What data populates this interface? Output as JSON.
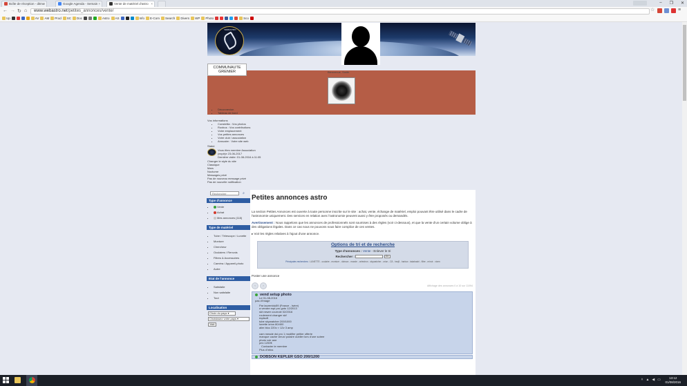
{
  "browser": {
    "tabs": [
      {
        "label": "Boîte de réception - ditmo",
        "favicon_color": "#d44638"
      },
      {
        "label": "Google Agenda - Semain",
        "favicon_color": "#4285f4"
      },
      {
        "label": "Vente de matériel d'astro",
        "favicon_color": "#333333"
      }
    ],
    "url_host": "www.webastro.net",
    "url_path": "/petites_annonces/vente/",
    "bookmarks": [
      "Up",
      "AV",
      "AM",
      "Prod",
      "SC",
      "Doc",
      "Astro",
      "AS",
      "Info",
      "E-Com",
      "Search",
      "Divers",
      "WP",
      "Photo",
      "Sco"
    ]
  },
  "site": {
    "logo_text": "WEBASTRO",
    "grenier_line1": "COMMUNAUTE",
    "grenier_line2": "GRENIER",
    "member_name": "Bienvenue, Smith",
    "user_links": [
      "Déconnexion",
      "Tableau de bord"
    ],
    "infos_label": "Vos informations",
    "info_links": [
      "Constellia : Vos photos",
      "Roxbus : Vos contributions",
      "Votre emplacement",
      "Vos petites annonces",
      "Votre club / association",
      "Annuaire : Votre site web"
    ],
    "statut_label": "Statut",
    "statut_line1": "Vous êtes membre Association",
    "statut_line2": "(expir)e 23-06-2017",
    "statut_line3": "Dernière visite: 01-08-2016 à 11:05",
    "style_label": "Changer le style du site",
    "styles": [
      "Classique",
      "Mars",
      "Nocturne"
    ],
    "messages_label": "Messages privé",
    "no_new_message": "Pas de nouveau message privé",
    "no_notification": "Pas de nouvelle notification"
  },
  "sidebar": {
    "search_placeholder": "Rechercher",
    "type_annonce_title": "Type d'annonce",
    "type_annonce": [
      {
        "label": "Vente",
        "color": "#3aa33a"
      },
      {
        "label": "Achat",
        "color": "#d33a2b"
      },
      {
        "label": "Mes annonces (118)",
        "color": "#c7c7c7"
      }
    ],
    "type_materiel_title": "Type de matériel",
    "type_materiel": [
      "Tube / Télescope / Lunette",
      "Monture",
      "Chercheur",
      "Oculaires / Renvois",
      "Filtres & Accessoires",
      "Caméra / Appareil-photo",
      "Autre"
    ],
    "etat_title": "Etat de l'annonce",
    "etat": [
      "Satisfaite",
      "Non satisfaite",
      "Tout"
    ],
    "localisation_title": "Localisation",
    "pays_select": "Choix du pays",
    "region_select": "Choisissez votre pays",
    "voir_label": "Voir"
  },
  "main": {
    "title": "Petites annonces astro",
    "intro": "La section Petites Annonces est ouverte à toute personne inscrite sur le site : achat, vente, échange de matériel, emploi pouvant être utilisé dans le cadre de l'astronomie uniquement. Des services en relation avec l'astronomie peuvent aussi y être proposés ou demandés.",
    "warning_label": "Avertissement :",
    "warning_text": "Nous rappelons que les annonces de professionnels sont soumises à des règles (voir ci-dessous), et que la vente d'un certain volume oblige à des obligations légales. Dans ce cas nous ne pouvons nous faire complice de ces ventes.",
    "rules_link": "Voir les règles relatives à l'ajout d'une annonce.",
    "filter_title": "Options de tri et de recherche",
    "filter_type_label": "Type d'annonces :",
    "filter_type_value": "Vente",
    "filter_remove": "- Enlever le tri",
    "filter_search_label": "Rechercher :",
    "filter_go": "Go",
    "quick_label": "Principales recherches :",
    "quick_terms": "LUNETTE - oculaire - monture - dobson - maxde - celestron - skywatcher - orion - C8 - heq5 - barlow - takahashi - filtre - miroir - vixen",
    "post_ad": "Poster une annonce",
    "pager_prev": "‹",
    "pager_next": "›",
    "display_text": "Affichage des annonces 0 à 10 sur 11094",
    "ads": [
      {
        "title": "vend setup photo",
        "date": "Le 01-08-2016",
        "photo_note": "pas d'image",
        "body": [
          "Par laurentdu59 (France - Isère)",
          "a vendre eqd pro goto 12/2013",
          "skt newer courroie 02/2016",
          "roulement changer skf",
          "eqdsoft",
          "tube skywatcher 200/1000",
          "lunette orion 80/400",
          "alim bloc 220v > 12v 3 amp",
          "",
          "cam meade dsi pro 1 modifier peltier offerte",
          "manque cache vieux/ polaire oublier lors d'une soiree",
          "photo voir ane",
          "prix 1200€",
          "Contacter le membre",
          "Plus d'infos"
        ]
      },
      {
        "title": "DOBSON KEPLER GSO 200/1200",
        "date": "",
        "photo_note": "",
        "body": []
      }
    ]
  },
  "taskbar": {
    "time": "13:12",
    "date": "01/08/2016"
  }
}
